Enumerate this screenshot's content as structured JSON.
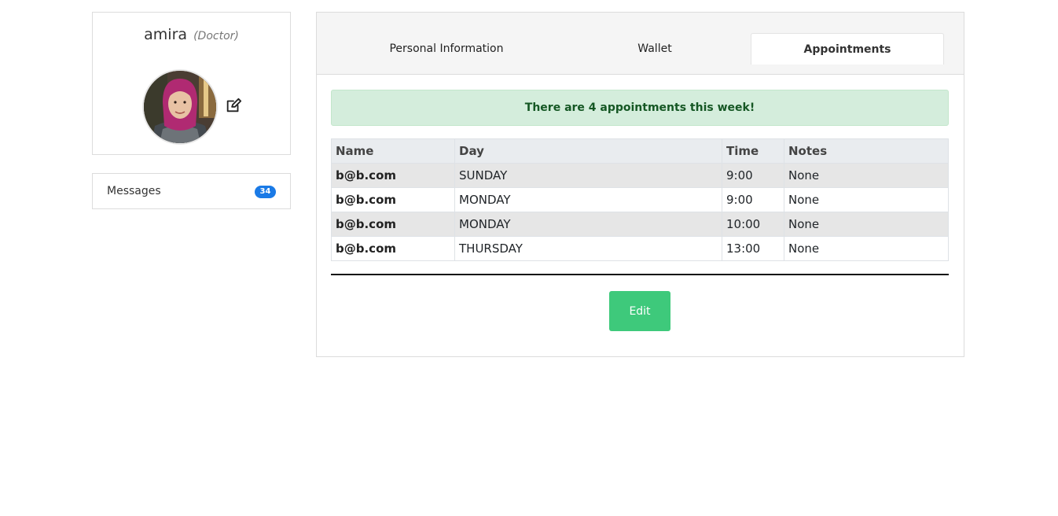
{
  "profile": {
    "name": "amira",
    "role": "(Doctor)",
    "edit_icon": "edit-icon"
  },
  "messages": {
    "label": "Messages",
    "count": "34",
    "badge_color": "#1a7ae6"
  },
  "tabs": [
    {
      "label": "Personal Information",
      "active": false
    },
    {
      "label": "Wallet",
      "active": false
    },
    {
      "label": "Appointments",
      "active": true
    }
  ],
  "alert": {
    "text": "There are 4 appointments this week!",
    "color": "#155724",
    "background": "#d4eddc"
  },
  "table": {
    "headers": [
      "Name",
      "Day",
      "Time",
      "Notes"
    ],
    "rows": [
      [
        "b@b.com",
        "SUNDAY",
        "9:00",
        "None"
      ],
      [
        "b@b.com",
        "MONDAY",
        "9:00",
        "None"
      ],
      [
        "b@b.com",
        "MONDAY",
        "10:00",
        "None"
      ],
      [
        "b@b.com",
        "THURSDAY",
        "13:00",
        "None"
      ]
    ]
  },
  "edit_button": {
    "label": "Edit",
    "color": "#3ec97b"
  }
}
